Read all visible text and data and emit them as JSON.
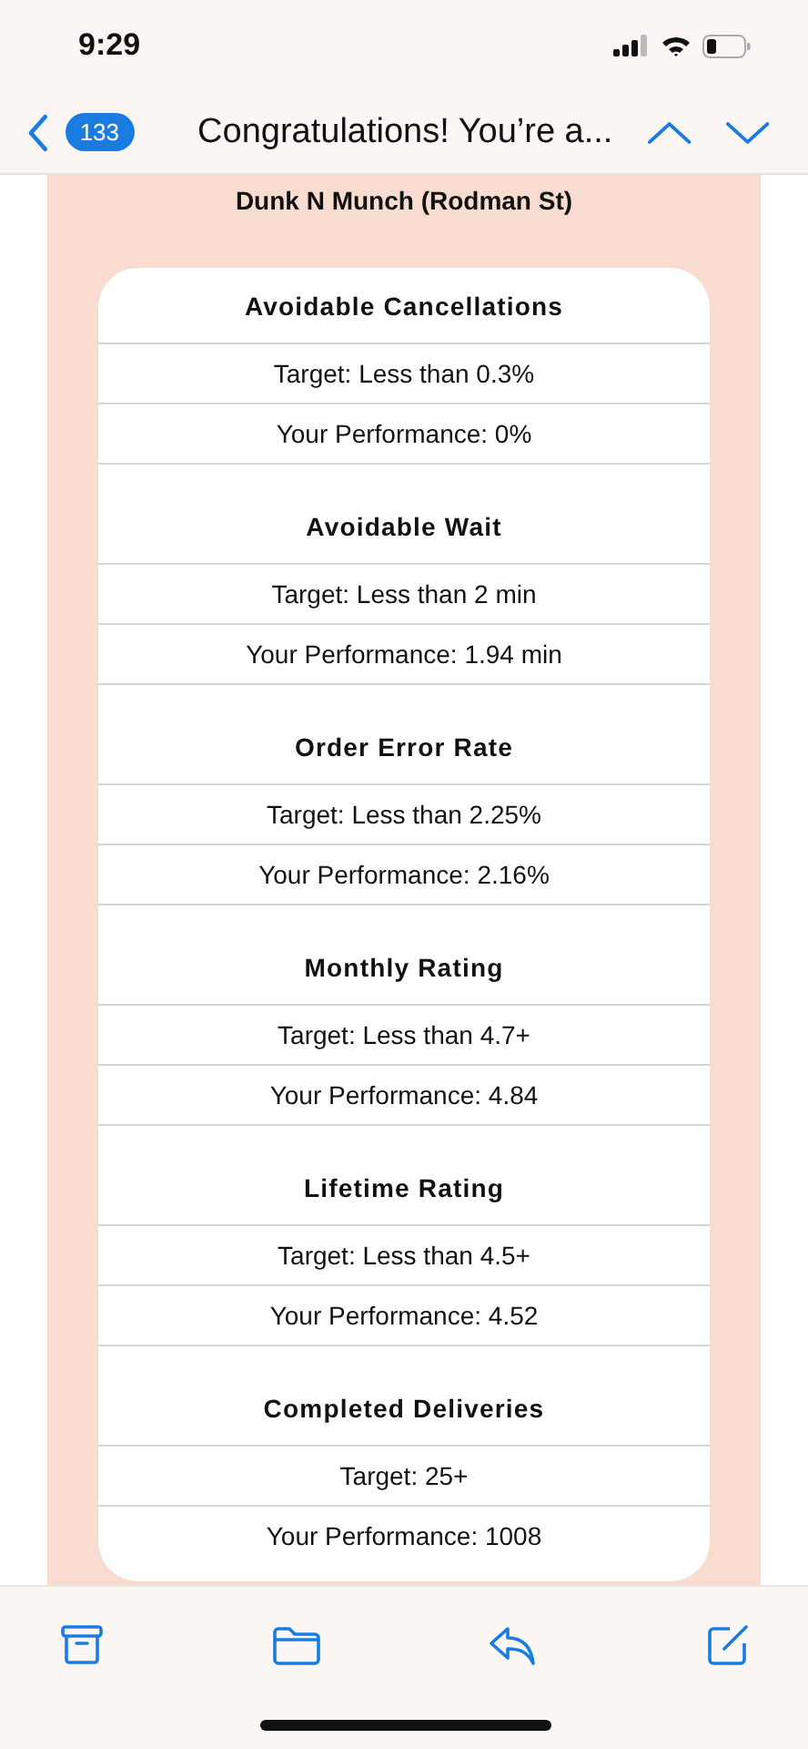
{
  "status_bar": {
    "time": "9:29"
  },
  "nav": {
    "unread_count": "133",
    "title": "Congratulations! You’re a..."
  },
  "store_name": "Dunk N Munch (Rodman St)",
  "metrics": [
    {
      "title": "Avoidable Cancellations",
      "target": "Target: Less than 0.3%",
      "performance": "Your Performance: 0%"
    },
    {
      "title": "Avoidable Wait",
      "target": "Target: Less than 2 min",
      "performance": "Your Performance: 1.94 min"
    },
    {
      "title": "Order Error Rate",
      "target": "Target: Less than 2.25%",
      "performance": "Your Performance: 2.16%"
    },
    {
      "title": "Monthly Rating",
      "target": "Target: Less than 4.7+",
      "performance": "Your Performance: 4.84"
    },
    {
      "title": "Lifetime Rating",
      "target": "Target: Less than 4.5+",
      "performance": "Your Performance: 4.52"
    },
    {
      "title": "Completed Deliveries",
      "target": "Target: 25+",
      "performance": "Your Performance: 1008"
    }
  ]
}
